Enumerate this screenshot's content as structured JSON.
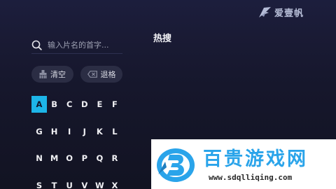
{
  "brand": {
    "name": "爱壹帆",
    "icon": "brand-logo-icon",
    "color": "#b6bdd6"
  },
  "search": {
    "placeholder": "输入片名的首字...",
    "icon": "search-icon"
  },
  "actions": {
    "clear_label": "清空",
    "clear_icon": "broom-icon",
    "backspace_label": "退格",
    "backspace_icon": "backspace-icon"
  },
  "keyboard": {
    "active_key": "A",
    "accent_color": "#1db5e8",
    "rows": [
      [
        "A",
        "B",
        "C",
        "D",
        "E",
        "F"
      ],
      [
        "G",
        "H",
        "I",
        "J",
        "K",
        "L"
      ],
      [
        "N",
        "M",
        "O",
        "P",
        "Q",
        "R"
      ],
      [
        "S",
        "T",
        "U",
        "V",
        "W",
        "X"
      ]
    ]
  },
  "hot_search": {
    "title": "热搜"
  },
  "watermark": {
    "title": "百贵游戏网",
    "url": "www.sdqlliqing.com",
    "title_color": "#2aa4ea"
  }
}
